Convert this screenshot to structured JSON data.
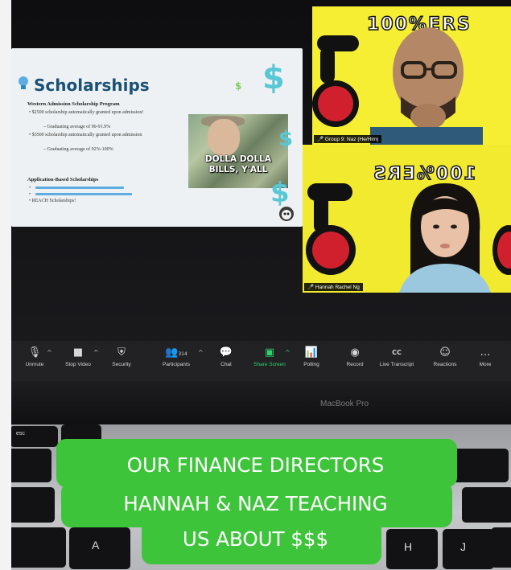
{
  "slide": {
    "title": "Scholarships",
    "program_heading": "Western Admission Scholarship Program",
    "bullets": [
      "$2500 scholarship automatically granted upon admission!",
      "Graduating average of 90-91.9%",
      "$3500 scholarship automatically granted upon admission",
      "Graduating average of 92%-100%"
    ],
    "application_heading": "Application-Based Scholarships",
    "reach_item": "REACH Scholarships!",
    "meme_caption_line1": "DOLLA DOLLA",
    "meme_caption_line2": "BILLS, Y'ALL"
  },
  "participants": [
    {
      "name": "Group 9: Naz (He/Him)",
      "banner_text": "100%ERS"
    },
    {
      "name": "Hannah Rachel Ng",
      "banner_text": "100%ERS"
    }
  ],
  "toolbar": {
    "items": [
      {
        "label": "Unmute",
        "icon": "microphone-muted-icon"
      },
      {
        "label": "Stop Video",
        "icon": "video-camera-icon"
      },
      {
        "label": "Security",
        "icon": "shield-icon"
      },
      {
        "label": "Participants",
        "icon": "people-icon",
        "count": "314"
      },
      {
        "label": "Chat",
        "icon": "chat-bubble-icon"
      },
      {
        "label": "Share Screen",
        "icon": "share-screen-icon"
      },
      {
        "label": "Polling",
        "icon": "bar-chart-icon"
      },
      {
        "label": "Record",
        "icon": "record-icon"
      },
      {
        "label": "Live Transcript",
        "icon": "cc-icon"
      },
      {
        "label": "Reactions",
        "icon": "emoji-plus-icon"
      },
      {
        "label": "More",
        "icon": "ellipsis-icon"
      }
    ],
    "share_color": "#2fd36c"
  },
  "laptop": {
    "brand": "MacBook Pro"
  },
  "keyboard": {
    "esc": "esc",
    "a": "A",
    "h": "H",
    "j": "J"
  },
  "caption": {
    "line1": "OUR FINANCE DIRECTORS",
    "line2": "HANNAH & NAZ TEACHING",
    "line3": "US ABOUT $$$",
    "background": "#3ec43b"
  }
}
